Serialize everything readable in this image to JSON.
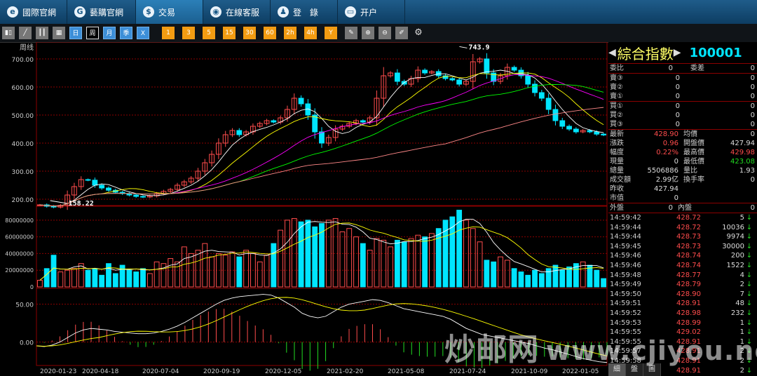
{
  "nav": [
    {
      "label": "國際官網",
      "icon": "globe-icon",
      "glyph": "e",
      "active": false
    },
    {
      "label": "藝購官網",
      "icon": "link-icon",
      "glyph": "G",
      "active": false
    },
    {
      "label": "交易",
      "icon": "dollar-icon",
      "glyph": "$",
      "active": true
    },
    {
      "label": "在線客服",
      "icon": "eye-icon",
      "glyph": "◉",
      "active": false
    },
    {
      "label": "登　錄",
      "icon": "user-icon",
      "glyph": "♟",
      "active": false
    },
    {
      "label": "开户",
      "icon": "card-icon",
      "glyph": "▭",
      "active": false
    }
  ],
  "toolbar": {
    "periods": [
      {
        "label": "日",
        "selected": false
      },
      {
        "label": "周",
        "selected": true
      },
      {
        "label": "月",
        "selected": false
      },
      {
        "label": "季",
        "selected": false
      },
      {
        "label": "X",
        "selected": false
      }
    ],
    "minutes": [
      "1",
      "3",
      "5",
      "15",
      "30",
      "60",
      "2h",
      "4h",
      "Y"
    ]
  },
  "chart_labels": {
    "period": "周线",
    "high_mark": "743.9",
    "low_mark": "158.22",
    "price_ticks": [
      "700.00",
      "600.00",
      "500.00",
      "400.00",
      "300.00",
      "200.00"
    ],
    "vol_ticks": [
      "80000000",
      "60000000",
      "40000000",
      "20000000",
      "0"
    ],
    "macd_ticks": [
      "50.00",
      "0.00"
    ],
    "dates": [
      "2020-01-23",
      "2020-04-18",
      "2020-07-04",
      "2020-09-19",
      "2020-12-05",
      "2021-02-20",
      "2021-05-08",
      "2021-07-24",
      "2021-10-09",
      "2022-01-05"
    ]
  },
  "chart_data": {
    "type": "candlestick",
    "frequency": "weekly",
    "x_labels": [
      "2020-01-23",
      "2020-04-18",
      "2020-07-04",
      "2020-09-19",
      "2020-12-05",
      "2021-02-20",
      "2021-05-08",
      "2021-07-24",
      "2021-10-09",
      "2022-01-05"
    ],
    "price_ylim": [
      180,
      740
    ],
    "volume_ylim": [
      0,
      95000000
    ],
    "macd_ylim": [
      -30,
      70
    ],
    "annotations": {
      "max": 743.9,
      "min": 158.22
    },
    "closes": [
      180,
      175,
      172,
      178,
      215,
      245,
      270,
      268,
      250,
      240,
      232,
      225,
      220,
      215,
      210,
      208,
      212,
      220,
      228,
      235,
      250,
      262,
      275,
      300,
      330,
      360,
      400,
      430,
      445,
      430,
      440,
      460,
      470,
      480,
      475,
      490,
      520,
      560,
      540,
      500,
      440,
      400,
      420,
      450,
      460,
      470,
      480,
      475,
      490,
      560,
      640,
      650,
      620,
      610,
      630,
      660,
      650,
      655,
      640,
      630,
      625,
      610,
      620,
      690,
      700,
      650,
      620,
      640,
      670,
      660,
      640,
      610,
      580,
      560,
      520,
      480,
      460,
      450,
      440,
      445,
      440,
      432,
      428.9
    ],
    "volumes": [
      8000000,
      22000000,
      38000000,
      18000000,
      20000000,
      22000000,
      28000000,
      20000000,
      22000000,
      14000000,
      28000000,
      16000000,
      26000000,
      20000000,
      18000000,
      22000000,
      16000000,
      30000000,
      28000000,
      34000000,
      30000000,
      48000000,
      40000000,
      44000000,
      52000000,
      36000000,
      40000000,
      38000000,
      42000000,
      36000000,
      44000000,
      40000000,
      30000000,
      38000000,
      52000000,
      68000000,
      80000000,
      82000000,
      78000000,
      80000000,
      72000000,
      76000000,
      80000000,
      82000000,
      66000000,
      70000000,
      60000000,
      52000000,
      44000000,
      58000000,
      56000000,
      48000000,
      56000000,
      54000000,
      58000000,
      62000000,
      60000000,
      64000000,
      70000000,
      80000000,
      84000000,
      92000000,
      80000000,
      70000000,
      54000000,
      32000000,
      30000000,
      36000000,
      32000000,
      22000000,
      18000000,
      14000000,
      20000000,
      16000000,
      22000000,
      26000000,
      20000000,
      24000000,
      28000000,
      30000000,
      26000000,
      20000000,
      10000000
    ],
    "macd_dif": [
      -5,
      -6,
      -4,
      0,
      6,
      12,
      16,
      18,
      17,
      16,
      14,
      13,
      12,
      11,
      11,
      12,
      14,
      17,
      21,
      26,
      32,
      38,
      44,
      50,
      55,
      58,
      60,
      61,
      62,
      63,
      62,
      58,
      52,
      46,
      38,
      34,
      32,
      34,
      40,
      46,
      50,
      52,
      54,
      56,
      55,
      52,
      48,
      44,
      42,
      40,
      38,
      36,
      34,
      30,
      24,
      18,
      14,
      10,
      8,
      6,
      4,
      2,
      0,
      -2,
      -5,
      -8,
      -10,
      -13,
      -16,
      -19,
      -22,
      -24,
      -26,
      -27
    ]
  },
  "quote": {
    "title": "綜合指數",
    "code": "100001",
    "weibi_label": "委比",
    "weibi_value": "0",
    "weicha_label": "委差",
    "weicha_value": "0",
    "sell": [
      {
        "label": "賣③",
        "price": "0",
        "vol": "0"
      },
      {
        "label": "賣②",
        "price": "0",
        "vol": "0"
      },
      {
        "label": "賣①",
        "price": "0",
        "vol": "0"
      }
    ],
    "buy": [
      {
        "label": "買①",
        "price": "0",
        "vol": "0"
      },
      {
        "label": "買②",
        "price": "0",
        "vol": "0"
      },
      {
        "label": "買③",
        "price": "0",
        "vol": "0"
      }
    ],
    "stats": [
      {
        "k1": "最新",
        "v1": "428.90",
        "c1": "red",
        "k2": "均價",
        "v2": "0",
        "c2": ""
      },
      {
        "k1": "漲跌",
        "v1": "0.96",
        "c1": "red",
        "k2": "開盤價",
        "v2": "427.94",
        "c2": ""
      },
      {
        "k1": "幅度",
        "v1": "0.22%",
        "c1": "red",
        "k2": "最高價",
        "v2": "429.98",
        "c2": "red"
      },
      {
        "k1": "現量",
        "v1": "0",
        "c1": "",
        "k2": "最低價",
        "v2": "423.08",
        "c2": "green"
      },
      {
        "k1": "總量",
        "v1": "5506886",
        "c1": "",
        "k2": "量比",
        "v2": "1.93",
        "c2": ""
      },
      {
        "k1": "成交額",
        "v1": "2.99亿",
        "c1": "",
        "k2": "換手率",
        "v2": "0",
        "c2": ""
      },
      {
        "k1": "昨收",
        "v1": "427.94",
        "c1": "",
        "k2": "",
        "v2": "",
        "c2": ""
      },
      {
        "k1": "市值",
        "v1": "0",
        "c1": "",
        "k2": "",
        "v2": "",
        "c2": ""
      }
    ],
    "outer_label": "外盤",
    "outer_value": "0",
    "inner_label": "內盤",
    "inner_value": "0"
  },
  "ticks": [
    {
      "t": "14:59:42",
      "p": "428.72",
      "v": "5"
    },
    {
      "t": "14:59:44",
      "p": "428.72",
      "v": "10036"
    },
    {
      "t": "14:59:44",
      "p": "428.73",
      "v": "9974"
    },
    {
      "t": "14:59:45",
      "p": "428.73",
      "v": "30000"
    },
    {
      "t": "14:59:46",
      "p": "428.74",
      "v": "200"
    },
    {
      "t": "14:59:46",
      "p": "428.74",
      "v": "1522"
    },
    {
      "t": "14:59:48",
      "p": "428.77",
      "v": "4"
    },
    {
      "t": "14:59:49",
      "p": "428.79",
      "v": "2"
    },
    {
      "t": "14:59:50",
      "p": "428.90",
      "v": "7"
    },
    {
      "t": "14:59:51",
      "p": "428.91",
      "v": "48"
    },
    {
      "t": "14:59:52",
      "p": "428.98",
      "v": "232"
    },
    {
      "t": "14:59:53",
      "p": "428.99",
      "v": "1"
    },
    {
      "t": "14:59:55",
      "p": "429.02",
      "v": "1"
    },
    {
      "t": "14:59:55",
      "p": "428.91",
      "v": "1"
    },
    {
      "t": "14:59:57",
      "p": "428.91",
      "v": "2"
    },
    {
      "t": "14:59:58",
      "p": "428.91",
      "v": "2"
    },
    {
      "t": "14:59:59",
      "p": "428.91",
      "v": "2"
    }
  ],
  "bottom_tabs": [
    "細",
    "盤",
    "圖"
  ],
  "watermark": {
    "cn": "炒邮网",
    "url": "www.cjiyou.net"
  },
  "colors": {
    "up": "#ff4c4c",
    "down": "#00e5ff",
    "ma5": "#ffffff",
    "ma10": "#ffff00",
    "ma20": "#ff00ff",
    "ma30": "#00ff00",
    "ma60": "#ff8888"
  }
}
